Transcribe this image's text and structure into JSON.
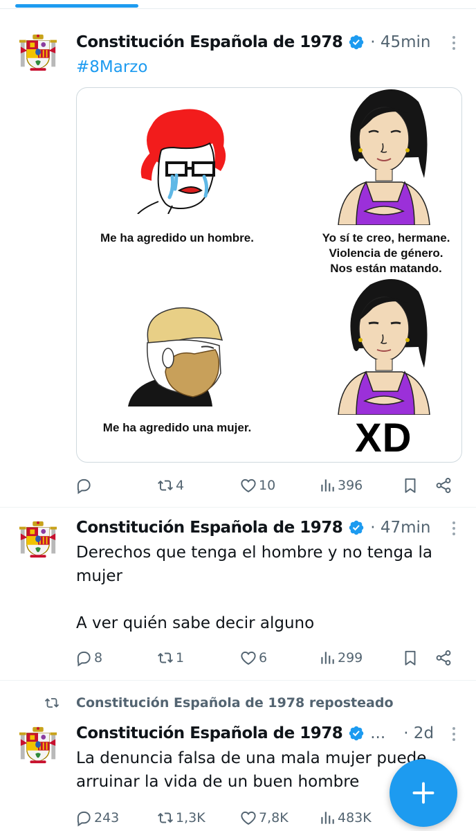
{
  "colors": {
    "accent": "#1d9bf0",
    "text": "#0f1419",
    "muted": "#536471"
  },
  "tweets": [
    {
      "author": "Constitución Española de 1978",
      "time": "· 45min",
      "hashtag": "#8Marzo",
      "media": {
        "panels": [
          {
            "caption": "Me ha agredido un hombre."
          },
          {
            "caption": "Yo sí te creo, hermane.\nViolencia de género.\nNos están matando."
          },
          {
            "caption": "Me ha agredido una mujer."
          },
          {
            "caption": "XD"
          }
        ]
      },
      "stats": {
        "replies": "",
        "reposts": "4",
        "likes": "10",
        "views": "396"
      }
    },
    {
      "author": "Constitución Española de 1978",
      "time": "· 47min",
      "text": "Derechos que tenga el hombre y no tenga la mujer\n\nA ver quién sabe decir alguno",
      "stats": {
        "replies": "8",
        "reposts": "1",
        "likes": "6",
        "views": "299"
      }
    },
    {
      "reposted_by": "Constitución Española de 1978 reposteado",
      "author": "Constitución Española de 1978",
      "author_overflow": "...",
      "time": "· 2d",
      "text": "La denuncia falsa de una mala mujer puede arruinar la vida de un buen hombre",
      "stats": {
        "replies": "243",
        "reposts": "1,3K",
        "likes": "7,8K",
        "views": "483K"
      }
    }
  ],
  "icons": {
    "reply": "reply-icon",
    "repost": "repost-icon",
    "like": "heart-icon",
    "views": "views-icon",
    "bookmark": "bookmark-icon",
    "share": "share-icon",
    "compose": "plus-icon",
    "verified": "verified-badge-icon",
    "more": "more-vertical-icon"
  }
}
